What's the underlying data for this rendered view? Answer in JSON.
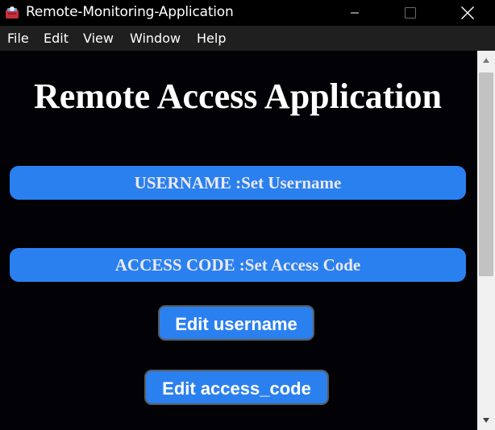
{
  "window": {
    "title": "Remote-Monitoring-Application"
  },
  "menu": {
    "items": [
      "File",
      "Edit",
      "View",
      "Window",
      "Help"
    ]
  },
  "main": {
    "title": "Remote Access Application",
    "username_bar": "USERNAME :Set Username",
    "access_code_bar": "ACCESS CODE :Set Access Code",
    "edit_username_button": "Edit username",
    "edit_access_code_button": "Edit access_code"
  },
  "colors": {
    "accent": "#2b80ef",
    "background": "#020206",
    "menubar": "#1f1f1f"
  },
  "icons": {
    "app": "app-logo-icon",
    "minimize": "minimize-icon",
    "maximize": "maximize-icon",
    "close": "close-icon",
    "scroll_up": "scroll-up-arrow-icon",
    "scroll_down": "scroll-down-arrow-icon"
  }
}
